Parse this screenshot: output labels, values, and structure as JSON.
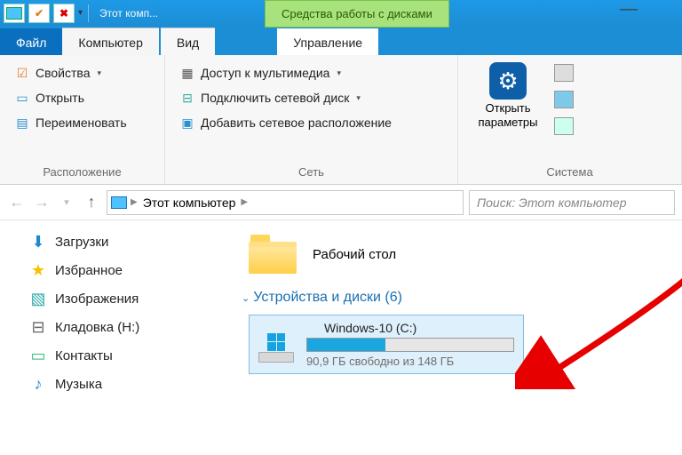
{
  "titlebar": {
    "title": "Этот комп..."
  },
  "context_tab": "Средства работы с дисками",
  "tabs": {
    "file": "Файл",
    "computer": "Компьютер",
    "view": "Вид",
    "manage": "Управление"
  },
  "ribbon": {
    "group1": {
      "label": "Расположение",
      "properties": "Свойства",
      "open": "Открыть",
      "rename": "Переименовать"
    },
    "group2": {
      "label": "Сеть",
      "media": "Доступ к мультимедиа",
      "map_drive": "Подключить сетевой диск",
      "add_location": "Добавить сетевое расположение"
    },
    "group3": {
      "label": "Система",
      "open_settings": "Открыть параметры"
    }
  },
  "address": {
    "root": "Этот компьютер",
    "search_placeholder": "Поиск: Этот компьютер"
  },
  "sidebar": {
    "items": [
      {
        "label": "Загрузки",
        "icon": "download"
      },
      {
        "label": "Избранное",
        "icon": "star"
      },
      {
        "label": "Изображения",
        "icon": "images"
      },
      {
        "label": "Кладовка (H:)",
        "icon": "drive"
      },
      {
        "label": "Контакты",
        "icon": "contacts"
      },
      {
        "label": "Музыка",
        "icon": "music"
      }
    ]
  },
  "content": {
    "desktop": "Рабочий стол",
    "devices_header": "Устройства и диски (6)",
    "drive": {
      "name": "Windows-10 (C:)",
      "free_text": "90,9 ГБ свободно из 148 ГБ",
      "fill_percent": 38
    }
  }
}
